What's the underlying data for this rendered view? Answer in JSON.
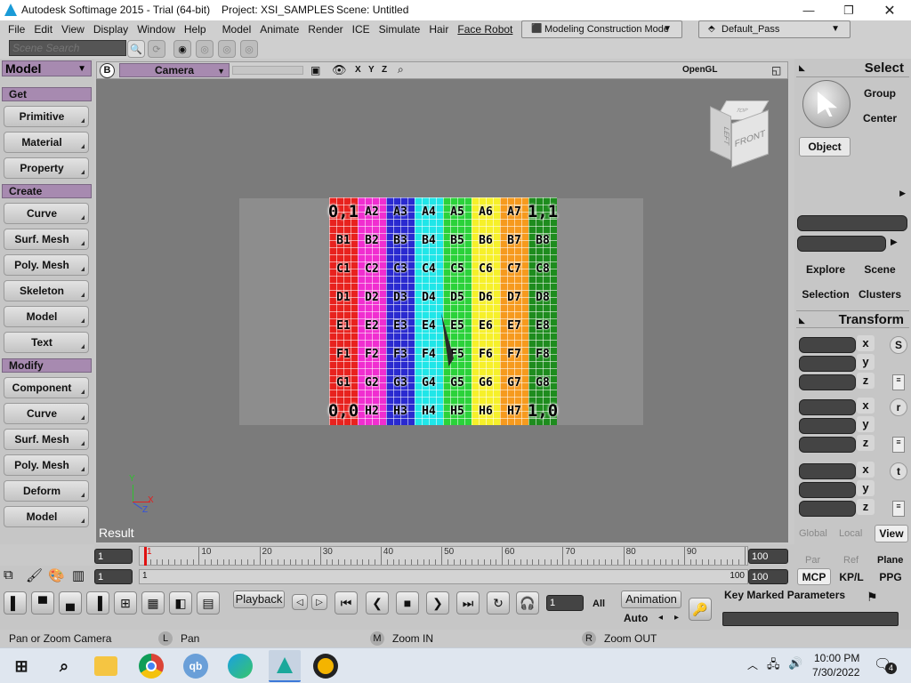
{
  "title": {
    "app": "Autodesk Softimage 2015 - Trial (64-bit)",
    "project": "Project: XSI_SAMPLES",
    "scene": "Scene: Untitled"
  },
  "menu": [
    "File",
    "Edit",
    "View",
    "Display",
    "Window",
    "Help",
    "Model",
    "Animate",
    "Render",
    "ICE",
    "Simulate",
    "Hair",
    "Face Robot"
  ],
  "mode_dropdown": "Modeling Construction Mode",
  "pass_dropdown": "Default_Pass",
  "search_placeholder": "Scene Search",
  "left_panel": {
    "title": "Model",
    "sections": [
      {
        "name": "Get",
        "buttons": [
          "Primitive",
          "Material",
          "Property"
        ]
      },
      {
        "name": "Create",
        "buttons": [
          "Curve",
          "Surf. Mesh",
          "Poly. Mesh",
          "Skeleton",
          "Model",
          "Text"
        ]
      },
      {
        "name": "Modify",
        "buttons": [
          "Component",
          "Curve",
          "Surf. Mesh",
          "Poly. Mesh",
          "Deform",
          "Model"
        ]
      }
    ]
  },
  "viewport": {
    "badge": "B",
    "camera": "Camera",
    "xyz": [
      "X",
      "Y",
      "Z"
    ],
    "renderer": "OpenGL",
    "cube_front": "FRONT",
    "cube_left": "LEFT",
    "cube_top": "TOP",
    "result_label": "Result",
    "axes": {
      "x": "X",
      "y": "Y",
      "z": "Z"
    }
  },
  "texture_grid": [
    [
      "0,1",
      "A2",
      "A3",
      "A4",
      "A5",
      "A6",
      "A7",
      "1,1"
    ],
    [
      "B1",
      "B2",
      "B3",
      "B4",
      "B5",
      "B6",
      "B7",
      "B8"
    ],
    [
      "C1",
      "C2",
      "C3",
      "C4",
      "C5",
      "C6",
      "C7",
      "C8"
    ],
    [
      "D1",
      "D2",
      "D3",
      "D4",
      "D5",
      "D6",
      "D7",
      "D8"
    ],
    [
      "E1",
      "E2",
      "E3",
      "E4",
      "E5",
      "E6",
      "E7",
      "E8"
    ],
    [
      "F1",
      "F2",
      "F3",
      "F4",
      "F5",
      "F6",
      "F7",
      "F8"
    ],
    [
      "G1",
      "G2",
      "G3",
      "G4",
      "G5",
      "G6",
      "G7",
      "G8"
    ],
    [
      "0,0",
      "H2",
      "H3",
      "H4",
      "H5",
      "H6",
      "H7",
      "1,0"
    ]
  ],
  "column_colors": [
    "#e8221e",
    "#f02ed0",
    "#2a2ad0",
    "#20e6e8",
    "#2bd23a",
    "#f6f02a",
    "#f69a1e",
    "#1e8c1e"
  ],
  "right_panel": {
    "select": "Select",
    "group": "Group",
    "center": "Center",
    "object": "Object",
    "explore": "Explore",
    "scene": "Scene",
    "selection": "Selection",
    "clusters": "Clusters",
    "transform": "Transform",
    "s": "S",
    "r": "r",
    "t": "t",
    "xyz": [
      "x",
      "y",
      "z"
    ],
    "global": "Global",
    "local": "Local",
    "view": "View",
    "par": "Par",
    "ref": "Ref",
    "plane": "Plane",
    "mcp": "MCP",
    "kpl": "KP/L",
    "ppg": "PPG"
  },
  "timeline": {
    "start_field": "1",
    "start_field2": "1",
    "labels": [
      "1",
      "10",
      "20",
      "30",
      "40",
      "50",
      "60",
      "70",
      "80",
      "90"
    ],
    "end_field": "100",
    "end_label": "100",
    "end_field2": "100",
    "sub_label": "1"
  },
  "bottom": {
    "playback": "Playback",
    "frame": "1",
    "all": "All",
    "animation": "Animation",
    "auto": "Auto",
    "kmp": "Key Marked Parameters"
  },
  "status": {
    "left": "Pan or Zoom Camera",
    "l_key": "L",
    "l_action": "Pan",
    "m_key": "M",
    "m_action": "Zoom IN",
    "r_key": "R",
    "r_action": "Zoom OUT"
  },
  "taskbar": {
    "time": "10:00 PM",
    "date": "7/30/2022",
    "notif": "4"
  }
}
